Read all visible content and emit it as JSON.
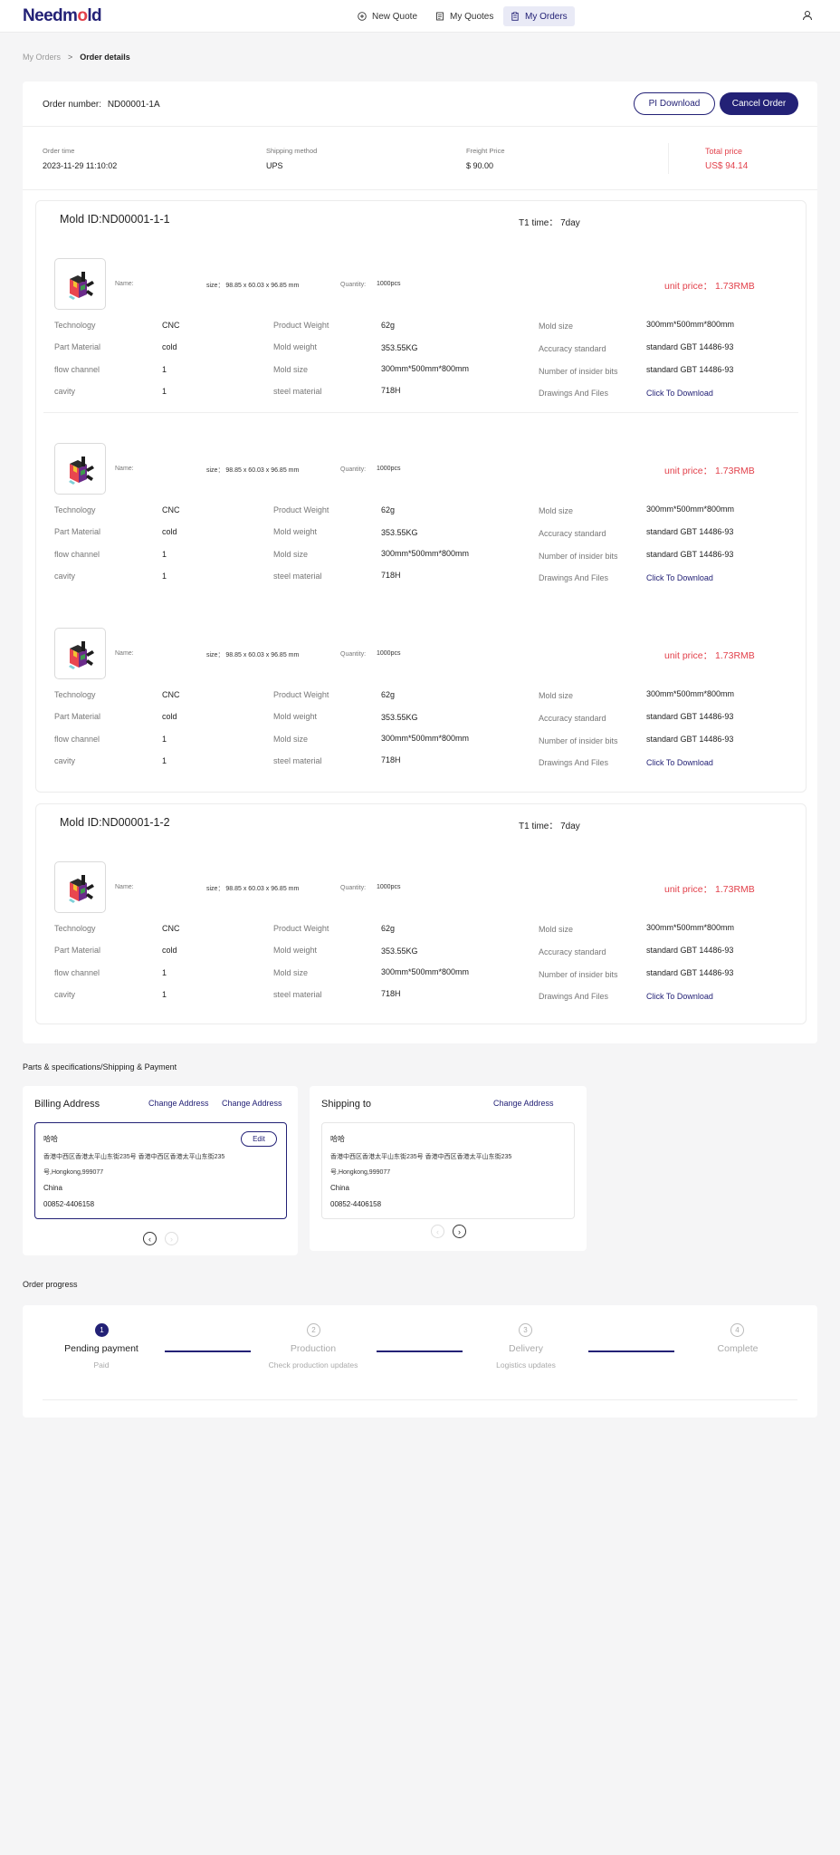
{
  "header": {
    "logo_main": "Needm",
    "logo_dot": "o",
    "logo_end": "ld",
    "nav": [
      {
        "label": "New Quote",
        "icon": "plus-circle-icon"
      },
      {
        "label": "My Quotes",
        "icon": "quote-doc-icon"
      },
      {
        "label": "My Orders",
        "icon": "clipboard-icon",
        "active": true
      }
    ],
    "user_icon": "user-icon"
  },
  "breadcrumb": {
    "parent": "My Orders",
    "separator": ">",
    "current": "Order details"
  },
  "order": {
    "number_label": "Order number:",
    "number": "ND00001-1A",
    "pi_download": "PI Download",
    "cancel": "Cancel Order",
    "meta": {
      "order_time_label": "Order time",
      "order_time": "2023-11-29 11:10:02",
      "shipping_label": "Shipping method",
      "shipping": "UPS",
      "freight_label": "Freight Price",
      "freight": "$ 90.00",
      "total_label": "Total price",
      "total": "US$ 94.14"
    }
  },
  "item_common": {
    "name_label": "Name:",
    "name_value": "",
    "size": "size： 98.85 x 60.03 x 96.85 mm",
    "quantity_label": "Quantity:",
    "quantity": "1000pcs",
    "unit_price": "unit price： 1.73RMB",
    "specs": {
      "technology_label": "Technology",
      "technology": "CNC",
      "material_label": "Part Material",
      "material": "cold",
      "flow_label": "flow channel",
      "flow": "1",
      "cavity_label": "cavity",
      "cavity": "1",
      "pweight_label": "Product Weight",
      "pweight": "62g",
      "mweight_label": "Mold weight",
      "mweight": "353.55KG",
      "msize_label": "Mold size",
      "msize": "300mm*500mm*800mm",
      "steel_label": "steel material",
      "steel": "718H",
      "moldsize_label": "Mold size",
      "moldsize": "300mm*500mm*800mm",
      "accuracy_label": "Accuracy standard",
      "accuracy": "standard GBT 14486-93",
      "insider_label": "Number of insider bits",
      "insider": "standard GBT 14486-93",
      "drawings_label": "Drawings And Files",
      "drawings": "Click To Download"
    }
  },
  "molds": [
    {
      "title": "Mold ID:ND00001-1-1",
      "t1": "T1 time： 7day"
    },
    {
      "title": "Mold ID:ND00001-1-2",
      "t1": "T1 time： 7day"
    }
  ],
  "address": {
    "section_title": "Parts & specifications/Shipping & Payment",
    "billing_title": "Billing Address",
    "change1": "Change Address",
    "change2": "Change Address",
    "shipping_title": "Shipping to",
    "change3": "Change Address",
    "edit": "Edit",
    "name": "哈哈",
    "line1": "香港中西区香港太平山东街235号 香港中西区香港太平山东街235",
    "line2": "号,Hongkong,999077",
    "country": "China",
    "phone": "00852-4406158"
  },
  "progress": {
    "title": "Order progress",
    "steps": [
      {
        "num": "1",
        "label": "Pending payment",
        "sub": "Paid",
        "active": true
      },
      {
        "num": "2",
        "label": "Production",
        "sub": "Check production updates",
        "active": false
      },
      {
        "num": "3",
        "label": "Delivery",
        "sub": "Logistics updates",
        "active": false
      },
      {
        "num": "4",
        "label": "Complete",
        "sub": "",
        "active": false
      }
    ]
  },
  "colors": {
    "brand": "#232176",
    "accent_red": "#e2414b",
    "background": "#f5f5f6"
  }
}
